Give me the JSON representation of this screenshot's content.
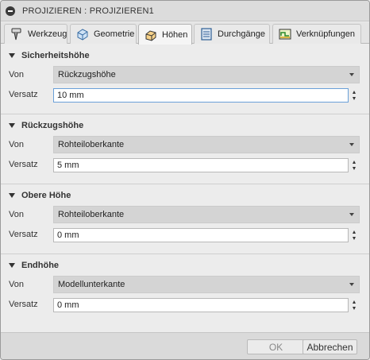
{
  "window": {
    "title": "PROJIZIEREN : PROJIZIEREN1"
  },
  "tabs": [
    {
      "label": "Werkzeug",
      "icon": "tool-icon"
    },
    {
      "label": "Geometrie",
      "icon": "geometry-icon"
    },
    {
      "label": "Höhen",
      "icon": "heights-icon",
      "active": true
    },
    {
      "label": "Durchgänge",
      "icon": "passes-icon"
    },
    {
      "label": "Verknüpfungen",
      "icon": "linking-icon"
    }
  ],
  "sections": [
    {
      "title": "Sicherheitshöhe",
      "from_label": "Von",
      "from_value": "Rückzugshöhe",
      "offset_label": "Versatz",
      "offset_value": "10 mm"
    },
    {
      "title": "Rückzugshöhe",
      "from_label": "Von",
      "from_value": "Rohteiloberkante",
      "offset_label": "Versatz",
      "offset_value": "5 mm"
    },
    {
      "title": "Obere Höhe",
      "from_label": "Von",
      "from_value": "Rohteiloberkante",
      "offset_label": "Versatz",
      "offset_value": "0 mm"
    },
    {
      "title": "Endhöhe",
      "from_label": "Von",
      "from_value": "Modellunterkante",
      "offset_label": "Versatz",
      "offset_value": "0 mm"
    }
  ],
  "footer": {
    "ok_label": "OK",
    "cancel_label": "Abbrechen"
  },
  "colors": {
    "active_tab_icon": "#f0a020",
    "focus_border": "#6aa0d8"
  }
}
